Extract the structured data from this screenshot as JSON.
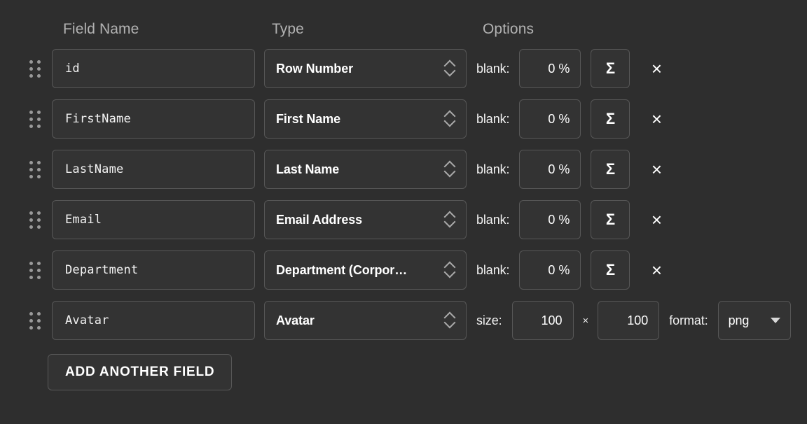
{
  "headers": {
    "field_name": "Field Name",
    "type": "Type",
    "options": "Options"
  },
  "rows": [
    {
      "field_name": "id",
      "type": "Row Number",
      "options_kind": "blank",
      "blank_label": "blank:",
      "blank_value": "0 %",
      "sigma_label": "Σ",
      "close_label": "×"
    },
    {
      "field_name": "FirstName",
      "type": "First Name",
      "options_kind": "blank",
      "blank_label": "blank:",
      "blank_value": "0 %",
      "sigma_label": "Σ",
      "close_label": "×"
    },
    {
      "field_name": "LastName",
      "type": "Last Name",
      "options_kind": "blank",
      "blank_label": "blank:",
      "blank_value": "0 %",
      "sigma_label": "Σ",
      "close_label": "×"
    },
    {
      "field_name": "Email",
      "type": "Email Address",
      "options_kind": "blank",
      "blank_label": "blank:",
      "blank_value": "0 %",
      "sigma_label": "Σ",
      "close_label": "×"
    },
    {
      "field_name": "Department",
      "type": "Department (Corpor…)",
      "type_display": "Department (Corpor…",
      "options_kind": "blank",
      "blank_label": "blank:",
      "blank_value": "0 %",
      "sigma_label": "Σ",
      "close_label": "×"
    },
    {
      "field_name": "Avatar",
      "type": "Avatar",
      "options_kind": "avatar",
      "size_label": "size:",
      "width_value": "100",
      "times_symbol": "×",
      "height_value": "100",
      "format_label": "format:",
      "format_value": "png"
    }
  ],
  "add_button": {
    "label": "ADD ANOTHER FIELD"
  },
  "colors": {
    "background": "#2e2e2e",
    "control_bg": "#333333",
    "border": "#575757",
    "text": "#ffffff",
    "muted_text": "#b2b2b2",
    "handle_dot": "#9a9a9a"
  }
}
